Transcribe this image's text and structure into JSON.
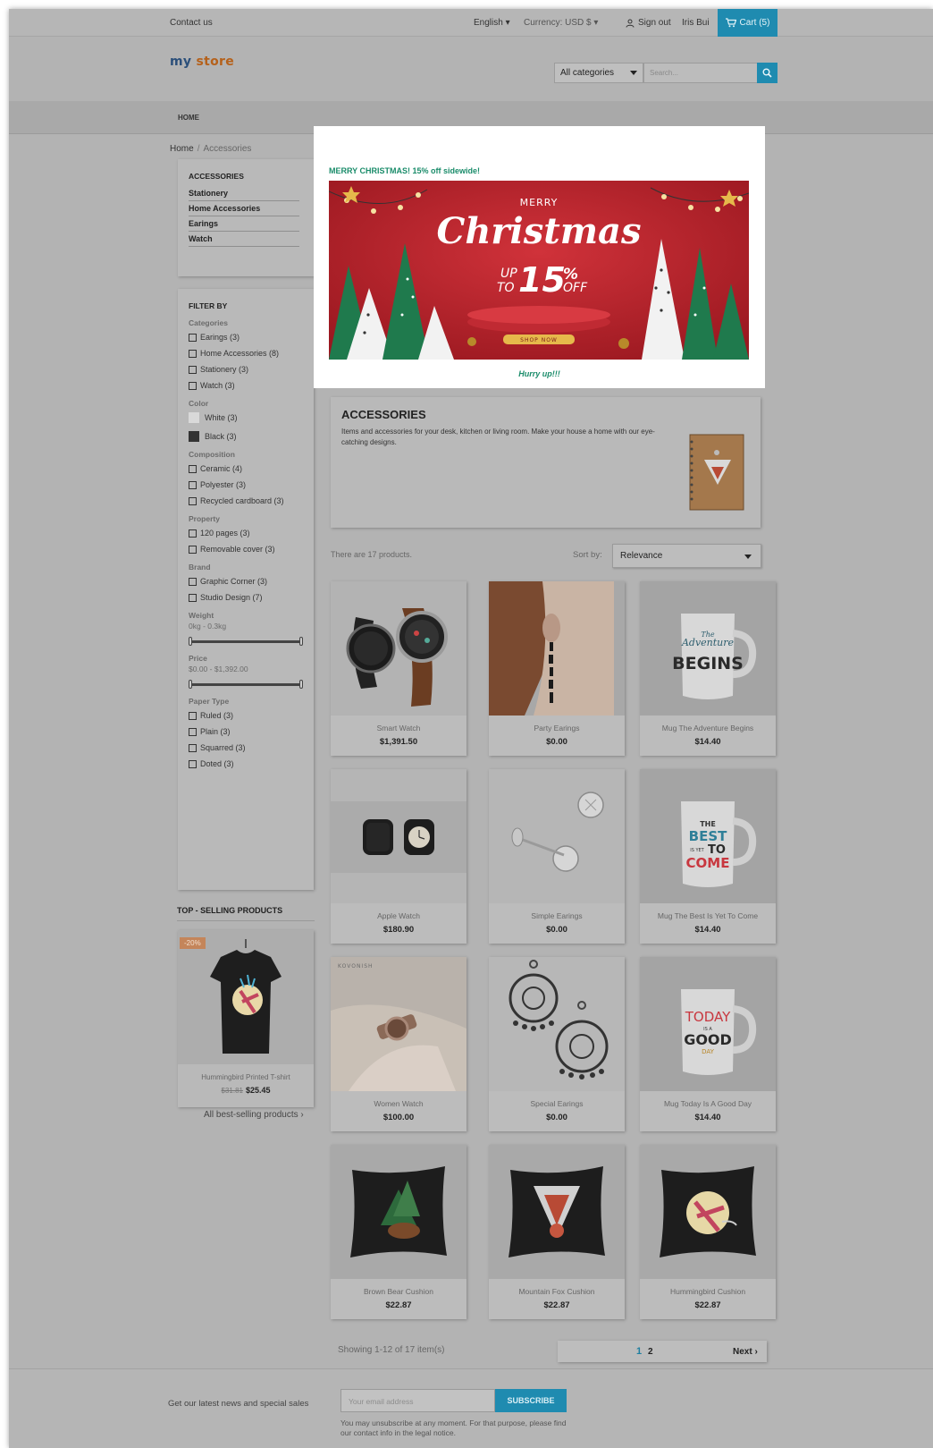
{
  "topbar": {
    "contact": "Contact us",
    "language": "English ▾",
    "currency": "Currency: USD $ ▾",
    "sign_out": "Sign out",
    "user": "Iris Bui",
    "cart": "Cart (5)"
  },
  "header": {
    "logo_part1": "my",
    "logo_part2": "store",
    "category_select": "All categories",
    "search_placeholder": "Search..."
  },
  "nav": {
    "home": "HOME"
  },
  "breadcrumb": {
    "home": "Home",
    "separator": "/",
    "current": "Accessories"
  },
  "sidebar": {
    "category_title": "ACCESSORIES",
    "categories": [
      "Stationery",
      "Home Accessories",
      "Earings",
      "Watch"
    ],
    "filter_title": "FILTER BY",
    "groups": {
      "categories": {
        "head": "Categories",
        "options": [
          "Earings (3)",
          "Home Accessories (8)",
          "Stationery (3)",
          "Watch (3)"
        ]
      },
      "color": {
        "head": "Color",
        "options": [
          "White (3)",
          "Black (3)"
        ],
        "swatches": [
          "#d9d9d9",
          "#333333"
        ]
      },
      "composition": {
        "head": "Composition",
        "options": [
          "Ceramic (4)",
          "Polyester (3)",
          "Recycled cardboard (3)"
        ]
      },
      "property": {
        "head": "Property",
        "options": [
          "120 pages (3)",
          "Removable cover (3)"
        ]
      },
      "brand": {
        "head": "Brand",
        "options": [
          "Graphic Corner (3)",
          "Studio Design (7)"
        ]
      },
      "weight": {
        "head": "Weight",
        "range": "0kg - 0.3kg"
      },
      "price": {
        "head": "Price",
        "range": "$0.00 - $1,392.00"
      },
      "paper": {
        "head": "Paper Type",
        "options": [
          "Ruled (3)",
          "Plain (3)",
          "Squarred (3)",
          "Doted (3)"
        ]
      }
    },
    "top_selling_title": "TOP - SELLING PRODUCTS",
    "top_product": {
      "badge": "-20%",
      "name": "Hummingbird Printed T-shirt",
      "old_price": "$31.81",
      "price": "$25.45"
    },
    "all_best": "All best-selling products  ›"
  },
  "banner": {
    "headline": "MERRY CHRISTMAS! 15% off sidewide!",
    "merry": "MERRY",
    "christmas": "Christmas",
    "up_to": "UP",
    "to": "TO",
    "percent": "15",
    "pct_sign": "%",
    "off": "OFF",
    "shop_now": "SHOP NOW",
    "footer": "Hurry up!!!"
  },
  "category_info": {
    "title": "ACCESSORIES",
    "description": "Items and accessories for your desk, kitchen or living room. Make your house a home with our eye-catching designs."
  },
  "listing": {
    "count": "There are 17 products.",
    "sort_label": "Sort by:",
    "sort_value": "Relevance",
    "products": [
      {
        "name": "Smart Watch",
        "price": "$1,391.50"
      },
      {
        "name": "Party Earings",
        "price": "$0.00"
      },
      {
        "name": "Mug The Adventure Begins",
        "price": "$14.40"
      },
      {
        "name": "Apple Watch",
        "price": "$180.90"
      },
      {
        "name": "Simple Earings",
        "price": "$0.00"
      },
      {
        "name": "Mug The Best Is Yet To Come",
        "price": "$14.40"
      },
      {
        "name": "Women Watch",
        "price": "$100.00"
      },
      {
        "name": "Special Earings",
        "price": "$0.00"
      },
      {
        "name": "Mug Today Is A Good Day",
        "price": "$14.40"
      },
      {
        "name": "Brown Bear Cushion",
        "price": "$22.87"
      },
      {
        "name": "Mountain Fox Cushion",
        "price": "$22.87"
      },
      {
        "name": "Hummingbird Cushion",
        "price": "$22.87"
      }
    ],
    "showing": "Showing 1-12 of 17 item(s)",
    "page1": "1",
    "page2": "2",
    "next": "Next ›"
  },
  "mug_texts": {
    "m1_a": "The",
    "m1_b": "Adventure",
    "m1_c": "BEGINS",
    "m2_a": "THE",
    "m2_b": "BEST",
    "m2_c": "IS YET",
    "m2_d": "TO",
    "m2_e": "COME",
    "m3_a": "TODAY",
    "m3_b": "IS A",
    "m3_c": "GOOD",
    "m3_d": "DAY"
  },
  "watch_brand": "KOVONISH",
  "footer": {
    "newsletter": "Get our latest news and special sales",
    "email_placeholder": "Your email address",
    "subscribe": "SUBSCRIBE",
    "note": "You may unsubscribe at any moment. For that purpose, please find our contact info in the legal notice."
  },
  "colors": {
    "accent": "#1f8bb0",
    "banner_red": "#b8202a",
    "banner_green": "#1a8c6a"
  }
}
